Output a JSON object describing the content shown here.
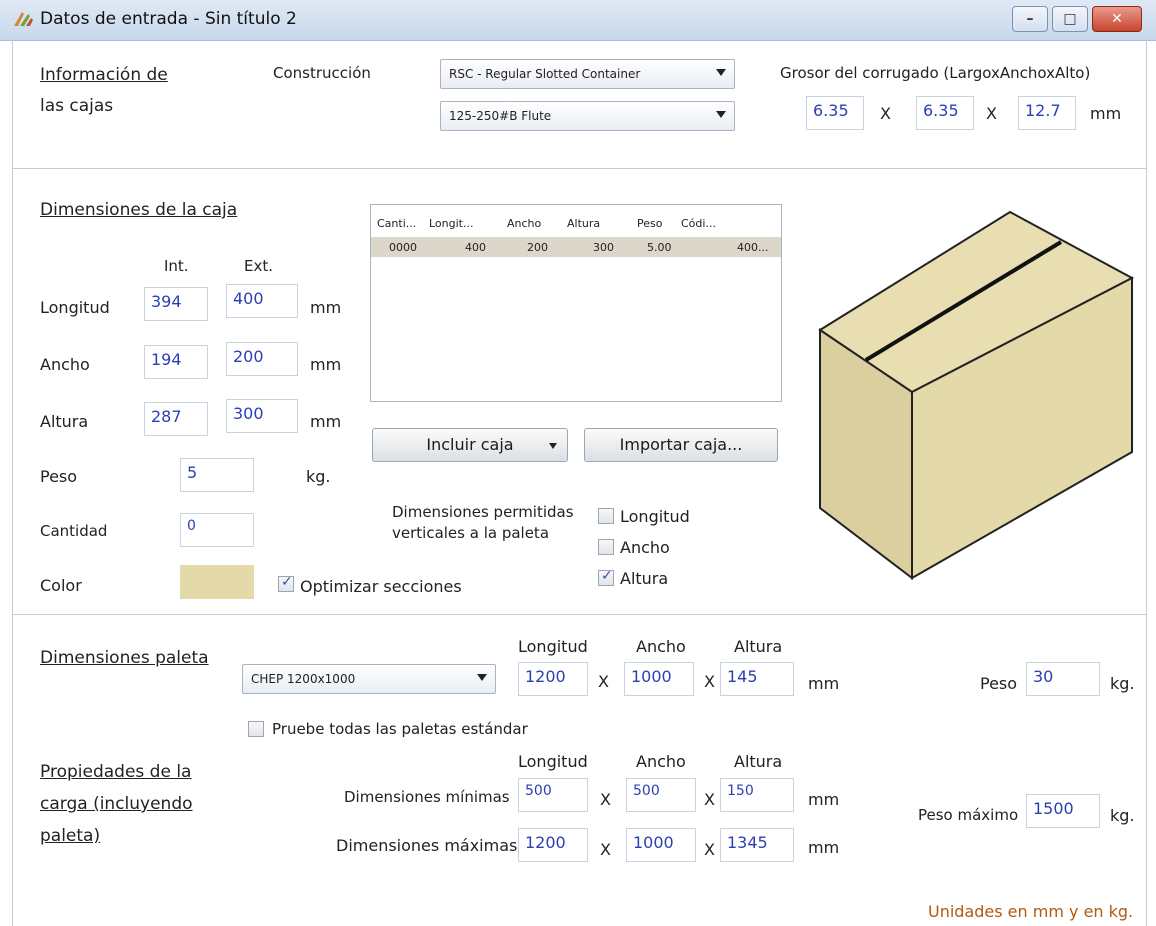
{
  "window": {
    "title": "Datos de entrada - Sin título 2",
    "min": "–",
    "max": "□",
    "close": "✕"
  },
  "caja_info": {
    "section_line1": "Información de",
    "section_line2": "las cajas",
    "construccion_label": "Construcción",
    "construccion_value": "RSC - Regular Slotted Container",
    "flute_value": "125-250#B Flute",
    "grosor_label": "Grosor del corrugado (LargoxAnchoxAlto)",
    "grosor": [
      "6.35",
      "6.35",
      "12.7"
    ],
    "x": "X",
    "unit": "mm"
  },
  "dimensiones_caja": {
    "title": "Dimensiones de la caja",
    "int_label": "Int.",
    "ext_label": "Ext.",
    "rows": [
      {
        "label": "Longitud",
        "int": "394",
        "ext": "400",
        "unit": "mm"
      },
      {
        "label": "Ancho",
        "int": "194",
        "ext": "200",
        "unit": "mm"
      },
      {
        "label": "Altura",
        "int": "287",
        "ext": "300",
        "unit": "mm"
      }
    ],
    "peso_label": "Peso",
    "peso": "5",
    "peso_unit": "kg.",
    "cantidad_label": "Cantidad",
    "cantidad": "0",
    "color_label": "Color",
    "color_hex": "#e4d9a9",
    "optimizar_label": "Optimizar secciones",
    "optimizar_checked": true
  },
  "tabla": {
    "headers": [
      "Canti...",
      "Longit...",
      "Ancho",
      "Altura",
      "Peso",
      "Códi..."
    ],
    "rows": [
      [
        "0000",
        "400",
        "200",
        "300",
        "5.00",
        "400..."
      ]
    ]
  },
  "botones": {
    "incluir": "Incluir caja",
    "importar": "Importar caja..."
  },
  "verticales": {
    "label_line1": "Dimensiones permitidas",
    "label_line2": "verticales a la paleta",
    "opciones": [
      {
        "label": "Longitud",
        "checked": false
      },
      {
        "label": "Ancho",
        "checked": false
      },
      {
        "label": "Altura",
        "checked": true
      }
    ]
  },
  "paleta": {
    "title": "Dimensiones paleta",
    "select": "CHEP 1200x1000",
    "col_longitud": "Longitud",
    "col_ancho": "Ancho",
    "col_altura": "Altura",
    "longitud": "1200",
    "ancho": "1000",
    "altura": "145",
    "x": "X",
    "unit": "mm",
    "peso_label": "Peso",
    "peso": "30",
    "peso_unit": "kg.",
    "pruebe_label": "Pruebe todas las paletas estándar"
  },
  "carga": {
    "title_line1": "Propiedades de la",
    "title_line2": "carga (incluyendo",
    "title_line3": "paleta)",
    "col_longitud": "Longitud",
    "col_ancho": "Ancho",
    "col_altura": "Altura",
    "min_label": "Dimensiones mínimas",
    "min": [
      "500",
      "500",
      "150"
    ],
    "max_label": "Dimensiones máximas",
    "max": [
      "1200",
      "1000",
      "1345"
    ],
    "x": "X",
    "unit": "mm",
    "peso_max_label": "Peso máximo",
    "peso_max": "1500",
    "peso_unit": "kg."
  },
  "footer": {
    "units_note": "Unidades en mm y en kg."
  }
}
